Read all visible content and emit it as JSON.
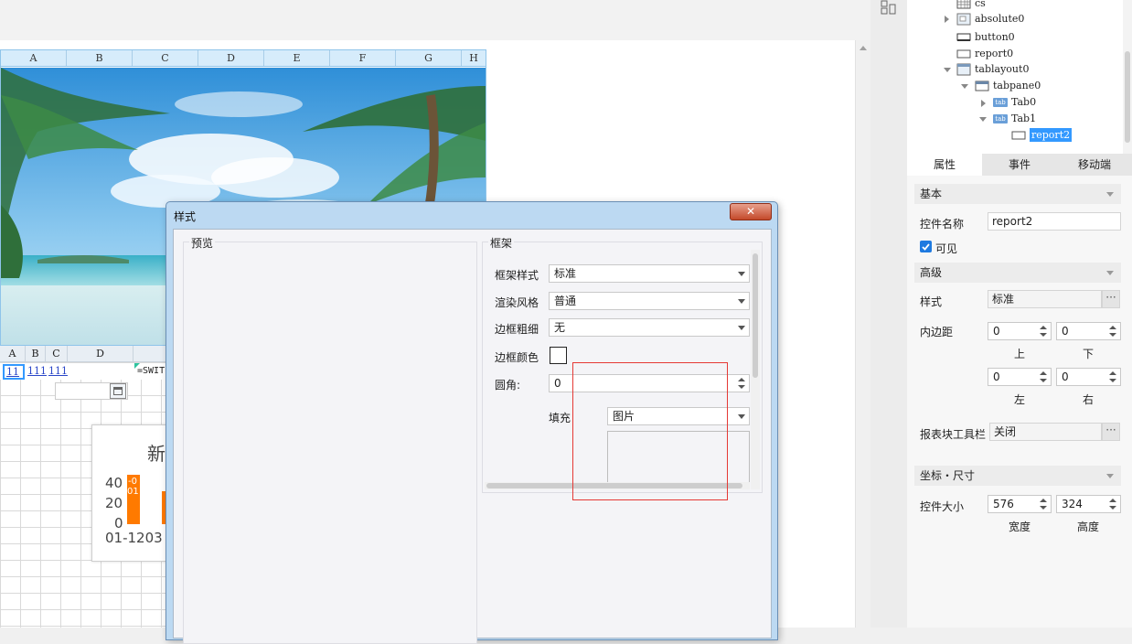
{
  "sheet": {
    "columns": [
      "A",
      "B",
      "C",
      "D",
      "E",
      "F",
      "G",
      "H"
    ],
    "lower_columns": [
      "A",
      "B",
      "C",
      "D"
    ],
    "cells": {
      "a1": "11",
      "b1": "111",
      "c1": "111",
      "formula": "=SWIT"
    }
  },
  "chart_data": {
    "type": "bar",
    "title": "新",
    "y_ticks": [
      "40",
      "20",
      "0"
    ],
    "x_label": "01-1203",
    "bar_labels": [
      "-0",
      "01"
    ],
    "colors": {
      "bar": "#ff7a00"
    }
  },
  "dialog": {
    "title": "样式",
    "close_label": "✕",
    "preview_label": "预览",
    "frame_label": "框架",
    "rows": {
      "frame_style": {
        "label": "框架样式",
        "value": "标准"
      },
      "render_style": {
        "label": "渲染风格",
        "value": "普通"
      },
      "border_width": {
        "label": "边框粗细",
        "value": "无"
      },
      "border_color": {
        "label": "边框颜色"
      },
      "corner": {
        "label": "圆角:",
        "value": "0"
      },
      "fill": {
        "label": "填充",
        "value": "图片"
      }
    }
  },
  "tree": {
    "nodes": [
      {
        "label": "cs"
      },
      {
        "label": "absolute0"
      },
      {
        "label": "button0"
      },
      {
        "label": "report0"
      },
      {
        "label": "tablayout0"
      },
      {
        "label": "tabpane0"
      },
      {
        "label": "Tab0"
      },
      {
        "label": "Tab1"
      },
      {
        "label": "report2"
      }
    ],
    "tab_icon_text": "tab"
  },
  "panel": {
    "tabs": [
      "属性",
      "事件",
      "移动端"
    ],
    "basic": {
      "section": "基本",
      "name_label": "控件名称",
      "name_value": "report2",
      "visible_label": "可见",
      "visible_checked": true
    },
    "advanced": {
      "section": "高级",
      "style_label": "样式",
      "style_value": "标准",
      "padding_label": "内边距",
      "padding": {
        "top": "0",
        "bottom": "0",
        "left": "0",
        "right": "0"
      },
      "top_label": "上",
      "bottom_label": "下",
      "left_label": "左",
      "right_label": "右",
      "toolbar_label": "报表块工具栏",
      "toolbar_value": "关闭",
      "dots": "···"
    },
    "coords": {
      "section": "坐标・尺寸",
      "size_label": "控件大小",
      "width": "576",
      "height": "324",
      "width_label": "宽度",
      "height_label": "高度"
    }
  },
  "colors": {
    "accent": "#3d8ee0",
    "selection": "#3399ff",
    "dialog_frame": "#bcd9f2",
    "highlight_box": "#e53935"
  }
}
